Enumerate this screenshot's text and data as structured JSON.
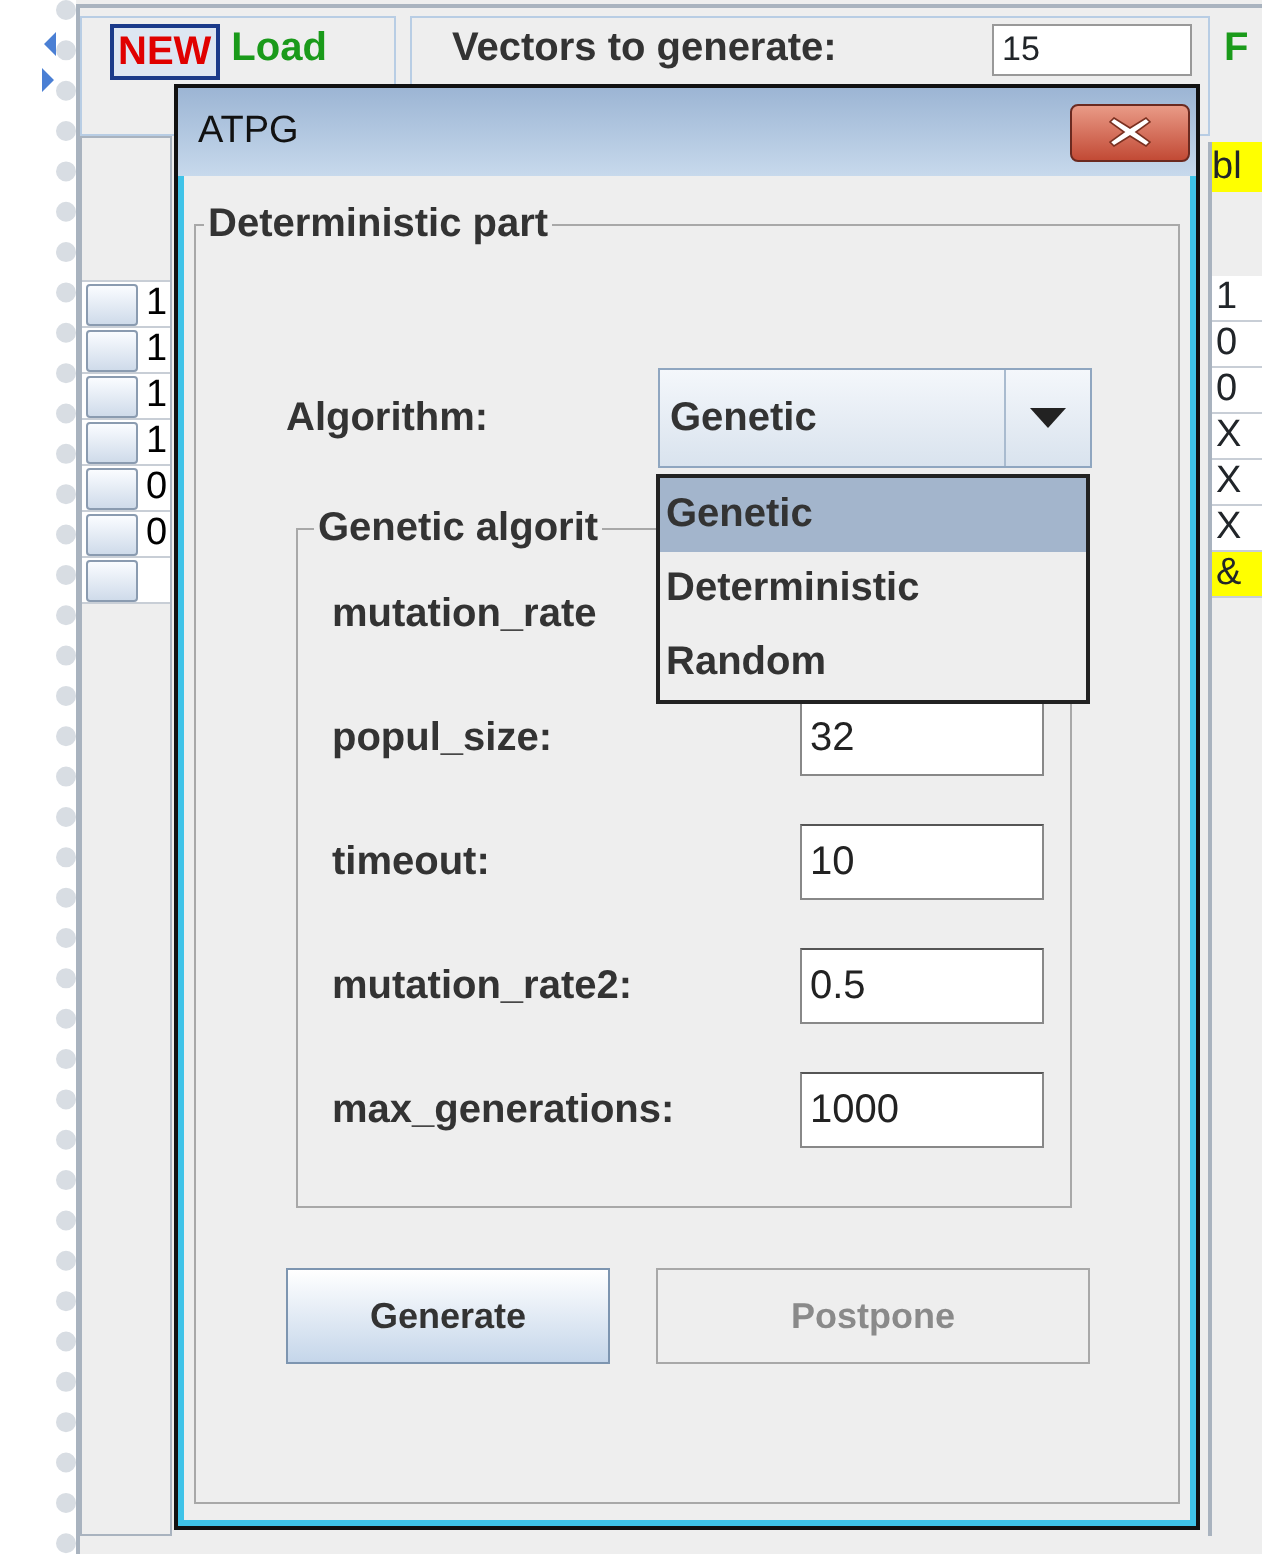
{
  "background_window": {
    "toolbar": {
      "new_button": "NEW",
      "load_button": "Load",
      "vectors_label": "Vectors to generate:",
      "vectors_value": "15",
      "column_label": "F"
    },
    "table": {
      "header_cell": "bl",
      "rows": [
        {
          "value": "1",
          "result": "1",
          "highlighted": false
        },
        {
          "value": "1",
          "result": "0",
          "highlighted": false
        },
        {
          "value": "1",
          "result": "0",
          "highlighted": false
        },
        {
          "value": "1",
          "result": "X",
          "highlighted": false
        },
        {
          "value": "0",
          "result": "X",
          "highlighted": false
        },
        {
          "value": "0",
          "result": "X",
          "highlighted": false
        },
        {
          "result": "&",
          "highlighted": true
        }
      ]
    }
  },
  "dialog": {
    "title": "ATPG",
    "group_title": "Deterministic part",
    "algorithm_label": "Algorithm:",
    "algorithm_value": "Genetic",
    "dropdown_open": true,
    "options": [
      {
        "label": "Genetic",
        "selected": true
      },
      {
        "label": "Deterministic",
        "selected": false
      },
      {
        "label": "Random",
        "selected": false
      }
    ],
    "genetic_group_title": "Genetic algorit",
    "params": [
      {
        "label": "mutation_rate"
      },
      {
        "label": "popul_size:",
        "value": "32"
      },
      {
        "label": "timeout:",
        "value": "10"
      },
      {
        "label": "mutation_rate2:",
        "value": "0.5"
      },
      {
        "label": "max_generations:",
        "value": "1000"
      }
    ],
    "buttons": [
      {
        "label": "Generate",
        "disabled": false
      },
      {
        "label": "Postpone",
        "disabled": true
      }
    ]
  }
}
